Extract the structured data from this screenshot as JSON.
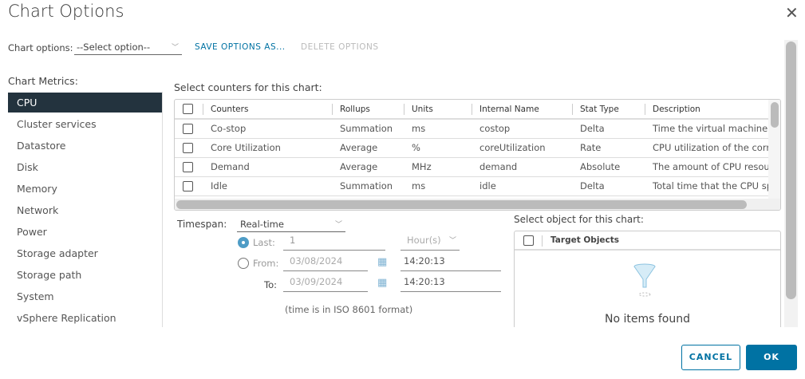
{
  "title": "Chart Options",
  "chart_options": {
    "label": "Chart options:",
    "value": "--Select option--",
    "save": "SAVE OPTIONS AS...",
    "delete": "DELETE OPTIONS"
  },
  "metrics": {
    "label": "Chart Metrics:",
    "items": [
      "CPU",
      "Cluster services",
      "Datastore",
      "Disk",
      "Memory",
      "Network",
      "Power",
      "Storage adapter",
      "Storage path",
      "System",
      "vSphere Replication"
    ],
    "selected": "CPU"
  },
  "counters": {
    "label": "Select counters for this chart:",
    "columns": [
      "Counters",
      "Rollups",
      "Units",
      "Internal Name",
      "Stat Type",
      "Description"
    ],
    "rows": [
      [
        "Co-stop",
        "Summation",
        "ms",
        "costop",
        "Delta",
        "Time the virtual machine is"
      ],
      [
        "Core Utilization",
        "Average",
        "%",
        "coreUtilization",
        "Rate",
        "CPU utilization of the corr"
      ],
      [
        "Demand",
        "Average",
        "MHz",
        "demand",
        "Absolute",
        "The amount of CPU resou"
      ],
      [
        "Idle",
        "Summation",
        "ms",
        "idle",
        "Delta",
        "Total time that the CPU sp"
      ]
    ]
  },
  "timespan": {
    "label": "Timespan:",
    "value": "Real-time",
    "last_label": "Last:",
    "last_value": "1",
    "last_unit": "Hour(s)",
    "from_label": "From:",
    "from_date": "03/08/2024",
    "from_time": "14:20:13",
    "to_label": "To:",
    "to_date": "03/09/2024",
    "to_time": "14:20:13",
    "note": "(time is in ISO 8601 format)",
    "selected": "Last"
  },
  "objects": {
    "label": "Select object for this chart:",
    "column": "Target Objects",
    "empty": "No items found"
  },
  "buttons": {
    "cancel": "CANCEL",
    "ok": "OK"
  },
  "colors": {
    "accent": "#0072a3",
    "selected_bg": "#23333e"
  }
}
